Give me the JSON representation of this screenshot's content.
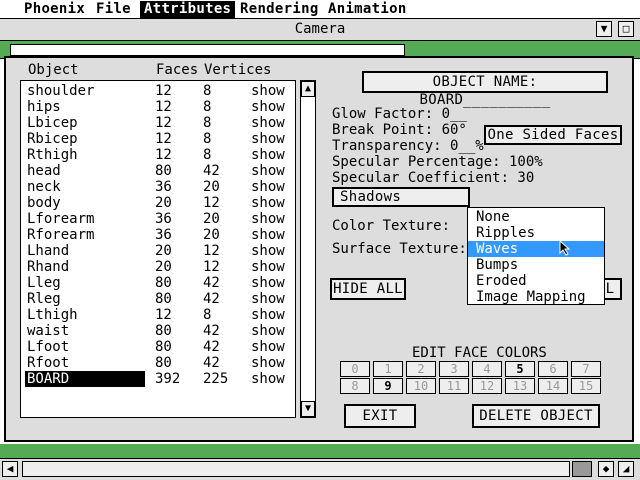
{
  "menubar": {
    "items": [
      {
        "label": "Phoenix"
      },
      {
        "label": "File"
      },
      {
        "label": "Attributes"
      },
      {
        "label": "Rendering"
      },
      {
        "label": "Animation"
      }
    ]
  },
  "window": {
    "title": "Camera"
  },
  "list": {
    "headers": {
      "object": "Object",
      "faces": "Faces",
      "vertices": "Vertices"
    },
    "rows": [
      {
        "name": "shoulder",
        "faces": "12",
        "vertices": "8",
        "action": "show"
      },
      {
        "name": "hips",
        "faces": "12",
        "vertices": "8",
        "action": "show"
      },
      {
        "name": "Lbicep",
        "faces": "12",
        "vertices": "8",
        "action": "show"
      },
      {
        "name": "Rbicep",
        "faces": "12",
        "vertices": "8",
        "action": "show"
      },
      {
        "name": "Rthigh",
        "faces": "12",
        "vertices": "8",
        "action": "show"
      },
      {
        "name": "head",
        "faces": "80",
        "vertices": "42",
        "action": "show"
      },
      {
        "name": "neck",
        "faces": "36",
        "vertices": "20",
        "action": "show"
      },
      {
        "name": "body",
        "faces": "20",
        "vertices": "12",
        "action": "show"
      },
      {
        "name": "Lforearm",
        "faces": "36",
        "vertices": "20",
        "action": "show"
      },
      {
        "name": "Rforearm",
        "faces": "36",
        "vertices": "20",
        "action": "show"
      },
      {
        "name": "Lhand",
        "faces": "20",
        "vertices": "12",
        "action": "show"
      },
      {
        "name": "Rhand",
        "faces": "20",
        "vertices": "12",
        "action": "show"
      },
      {
        "name": "Lleg",
        "faces": "80",
        "vertices": "42",
        "action": "show"
      },
      {
        "name": "Rleg",
        "faces": "80",
        "vertices": "42",
        "action": "show"
      },
      {
        "name": "Lthigh",
        "faces": "12",
        "vertices": "8",
        "action": "show"
      },
      {
        "name": "waist",
        "faces": "80",
        "vertices": "42",
        "action": "show"
      },
      {
        "name": "Lfoot",
        "faces": "80",
        "vertices": "42",
        "action": "show"
      },
      {
        "name": "Rfoot",
        "faces": "80",
        "vertices": "42",
        "action": "show"
      },
      {
        "name": "BOARD",
        "faces": "392",
        "vertices": "225",
        "action": "show",
        "selected": true
      }
    ]
  },
  "props": {
    "object_name": "OBJECT NAME: BOARD__________",
    "glow": "Glow Factor:  0__",
    "break": "Break Point:   60°",
    "transparency": "Transparency: 0__%",
    "spec_pct": "Specular Percentage: 100%",
    "spec_coef": "Specular Coefficient: 30",
    "one_sided": "One Sided Faces",
    "shadows": "Shadows",
    "color_texture": "Color Texture:",
    "surface_texture": "Surface Texture:",
    "hide_all": "HIDE ALL",
    "hidden_all_suffix": "L"
  },
  "dropdown": {
    "options": [
      "None",
      "Ripples",
      "Waves",
      "Bumps",
      "Eroded",
      "Image Mapping"
    ],
    "highlighted_index": 2
  },
  "face_colors": {
    "title": "EDIT FACE COLORS",
    "cells": [
      "0",
      "1",
      "2",
      "3",
      "4",
      "5",
      "6",
      "7",
      "8",
      "9",
      "10",
      "11",
      "12",
      "13",
      "14",
      "15"
    ],
    "current": [
      "5",
      "9"
    ]
  },
  "buttons": {
    "exit": "EXIT",
    "delete": "DELETE OBJECT"
  },
  "colors": {
    "highlight": "#3399ff",
    "strip_green": "#55aa55"
  }
}
